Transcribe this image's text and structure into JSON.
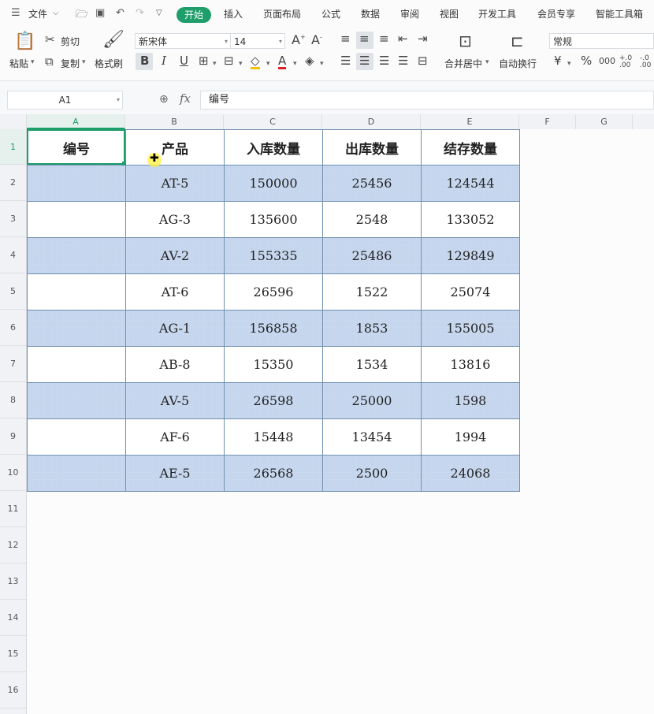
{
  "menubar": {
    "file_label": "文件",
    "tabs": [
      "开始",
      "插入",
      "页面布局",
      "公式",
      "数据",
      "审阅",
      "视图",
      "开发工具",
      "会员专享",
      "智能工具箱"
    ],
    "active_tab": "开始"
  },
  "ribbon": {
    "paste": "粘贴",
    "cut": "剪切",
    "copy": "复制",
    "format_painter": "格式刷",
    "font_name": "新宋体",
    "font_size": "14",
    "merge_center": "合并居中",
    "wrap_text": "自动换行",
    "number_format": "常规",
    "bold": "B",
    "italic": "I",
    "underline": "U",
    "font_color_glyph": "A",
    "increase_font": "A",
    "decrease_font": "A",
    "currency": "¥",
    "percent": "%",
    "thousands": "000",
    "inc_decimal": "+.0 .00",
    "dec_decimal": "-.0 .00"
  },
  "formula_bar": {
    "name_box": "A1",
    "fx": "fx",
    "content": "编号"
  },
  "columns": [
    "A",
    "B",
    "C",
    "D",
    "E",
    "F",
    "G"
  ],
  "active_column": "A",
  "rows": [
    "1",
    "2",
    "3",
    "4",
    "5",
    "6",
    "7",
    "8",
    "9",
    "10",
    "11",
    "12",
    "13",
    "14",
    "15",
    "16"
  ],
  "active_row": "1",
  "table": {
    "headers": [
      "编号",
      "产品",
      "入库数量",
      "出库数量",
      "结存数量"
    ],
    "rows": [
      [
        "",
        "AT-5",
        "150000",
        "25456",
        "124544"
      ],
      [
        "",
        "AG-3",
        "135600",
        "2548",
        "133052"
      ],
      [
        "",
        "AV-2",
        "155335",
        "25486",
        "129849"
      ],
      [
        "",
        "AT-6",
        "26596",
        "1522",
        "25074"
      ],
      [
        "",
        "AG-1",
        "156858",
        "1853",
        "155005"
      ],
      [
        "",
        "AB-8",
        "15350",
        "1534",
        "13816"
      ],
      [
        "",
        "AV-5",
        "26598",
        "25000",
        "1598"
      ],
      [
        "",
        "AF-6",
        "15448",
        "13454",
        "1994"
      ],
      [
        "",
        "AE-5",
        "26568",
        "2500",
        "24068"
      ]
    ]
  },
  "colors": {
    "accent": "#1e9e6a",
    "band": "#c8d8ef",
    "border": "#6f8fae"
  }
}
